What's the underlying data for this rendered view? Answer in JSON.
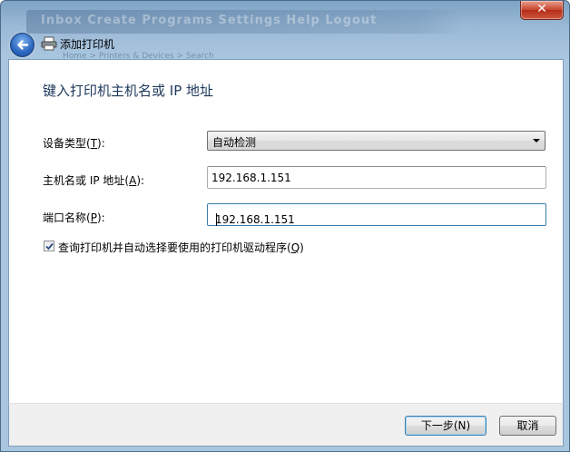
{
  "titlebar": {
    "close_label": "✕",
    "ghost_menu": "Inbox   Create   Programs   Settings   Help   Logout",
    "ghost_breadcrumb": "Home > Printers & Devices > Search"
  },
  "nav": {
    "title": "添加打印机"
  },
  "page": {
    "heading": "键入打印机主机名或 IP 地址"
  },
  "form": {
    "device_type": {
      "label": "设备类型(",
      "access_key": "T",
      "suffix": "):",
      "value": "自动检测"
    },
    "hostname": {
      "label": "主机名或 IP 地址(",
      "access_key": "A",
      "suffix": "):",
      "value": "192.168.1.151"
    },
    "port_name": {
      "label": "端口名称(",
      "access_key": "P",
      "suffix": "):",
      "value": "192.168.1.151"
    },
    "query_driver": {
      "label": "查询打印机并自动选择要使用的打印机驱动程序(",
      "access_key": "Q",
      "suffix": ")",
      "checked": true
    }
  },
  "footer": {
    "next_label": "下一步(N)",
    "cancel_label": "取消"
  },
  "colors": {
    "heading": "#1e395b",
    "titlebar": "#9bbad6",
    "close": "#c8442e"
  },
  "icons": [
    "back-arrow-icon",
    "printer-icon",
    "close-icon",
    "checkmark-icon",
    "dropdown-arrow-icon"
  ]
}
